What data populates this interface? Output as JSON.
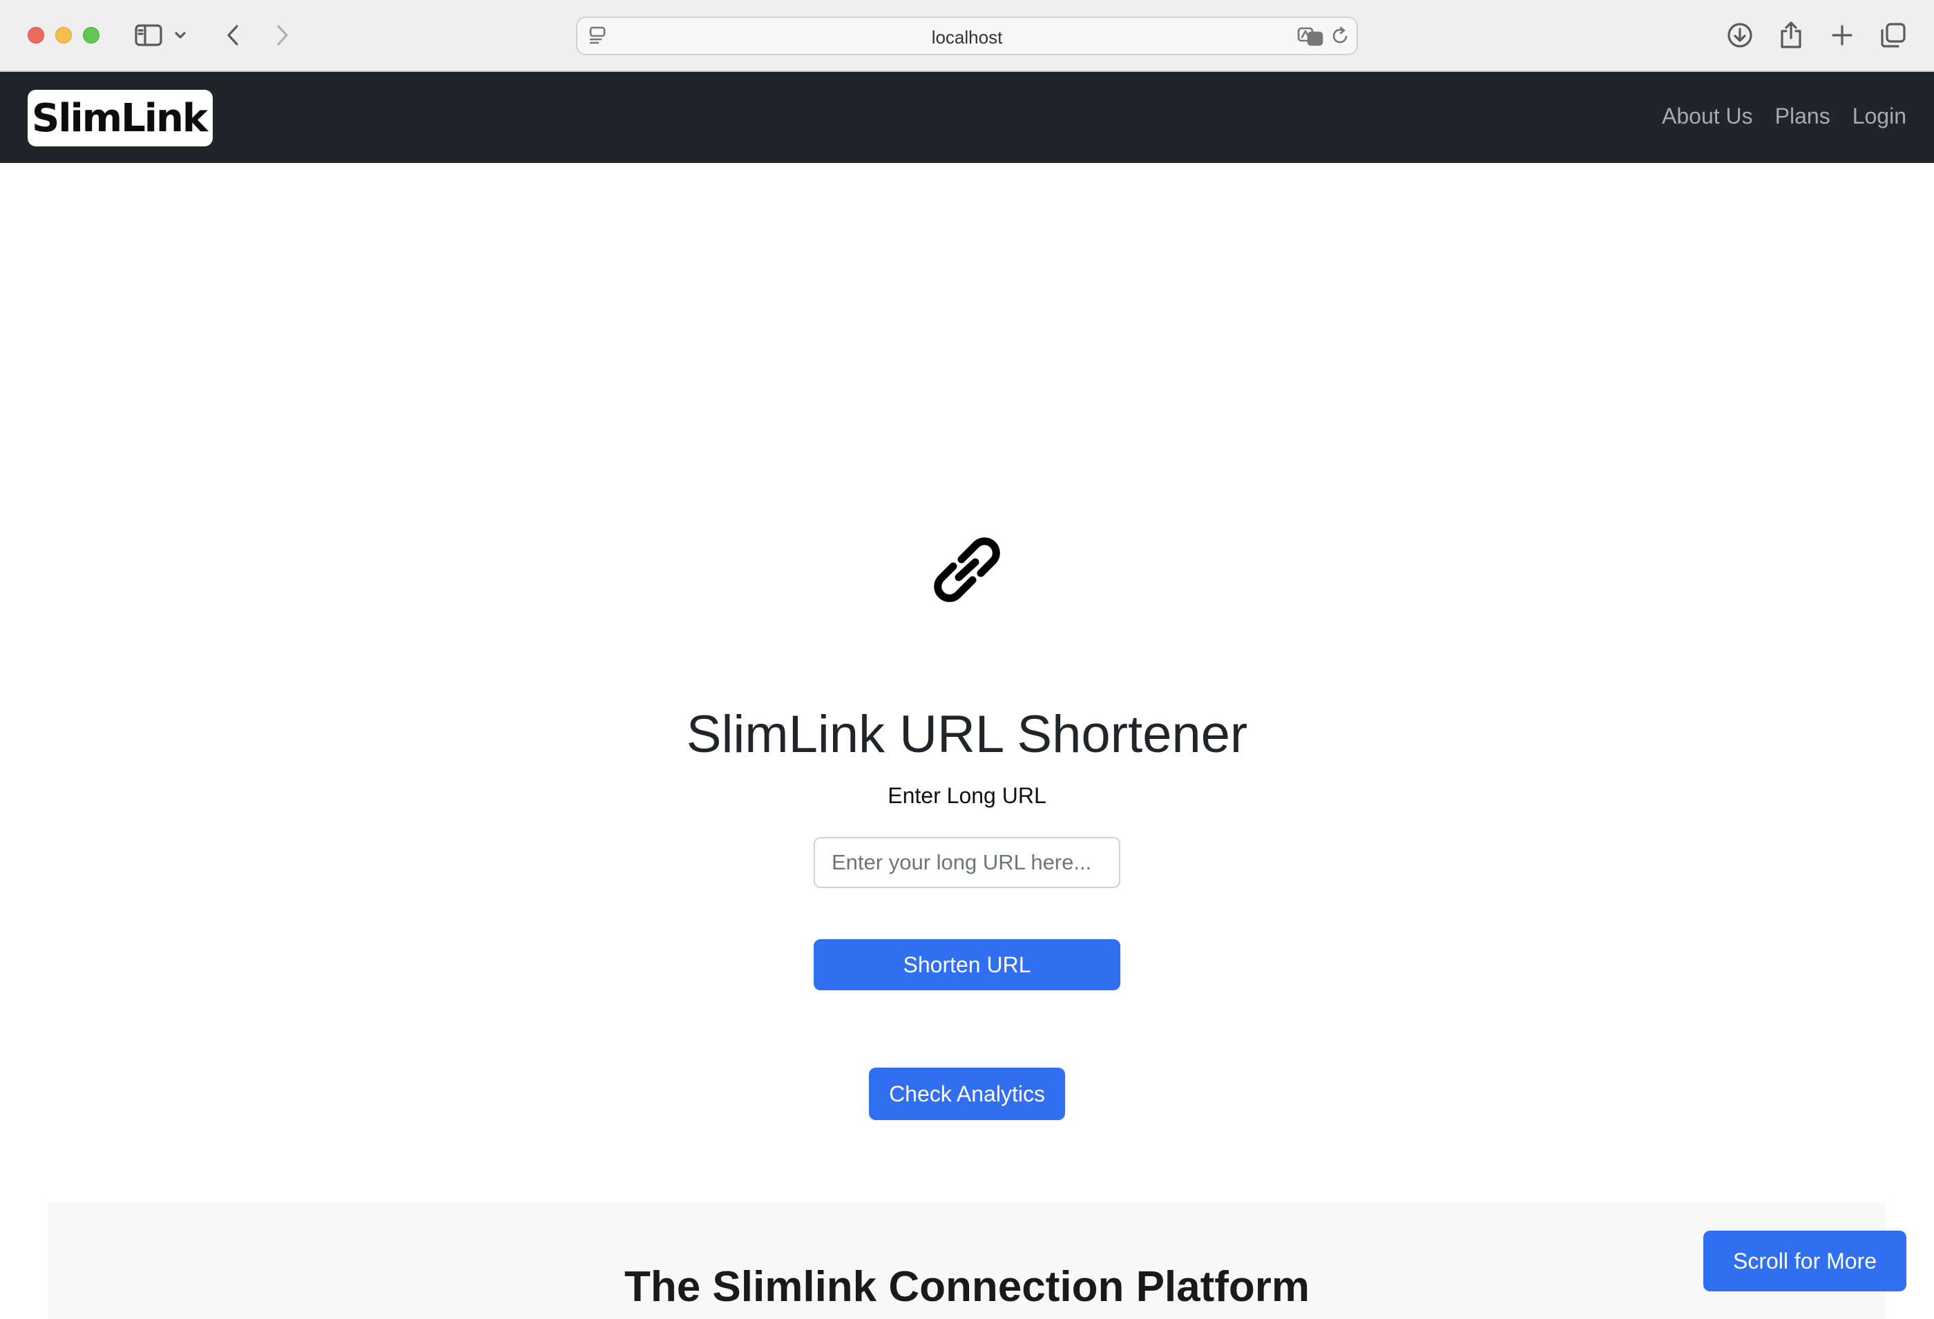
{
  "browser": {
    "address": "localhost",
    "icons": [
      "sidebar-icon",
      "chevron-down-icon",
      "back-icon",
      "forward-icon",
      "page-menu-icon",
      "translate-icon",
      "reload-icon",
      "download-icon",
      "share-icon",
      "new-tab-icon",
      "tabs-overview-icon"
    ]
  },
  "navbar": {
    "logo_text": "SlimLink",
    "links": [
      "About Us",
      "Plans",
      "Login"
    ]
  },
  "hero": {
    "icon": "link-icon",
    "title": "SlimLink URL Shortener",
    "label": "Enter Long URL",
    "input_placeholder": "Enter your long URL here...",
    "input_value": "",
    "shorten_button": "Shorten URL",
    "analytics_button": "Check Analytics"
  },
  "platform": {
    "title": "The Slimlink Connection Platform"
  },
  "scroll_button": "Scroll for More",
  "colors": {
    "navbar_bg": "#212529",
    "primary": "#2f6ff0",
    "nav_link": "#a8aaad"
  }
}
